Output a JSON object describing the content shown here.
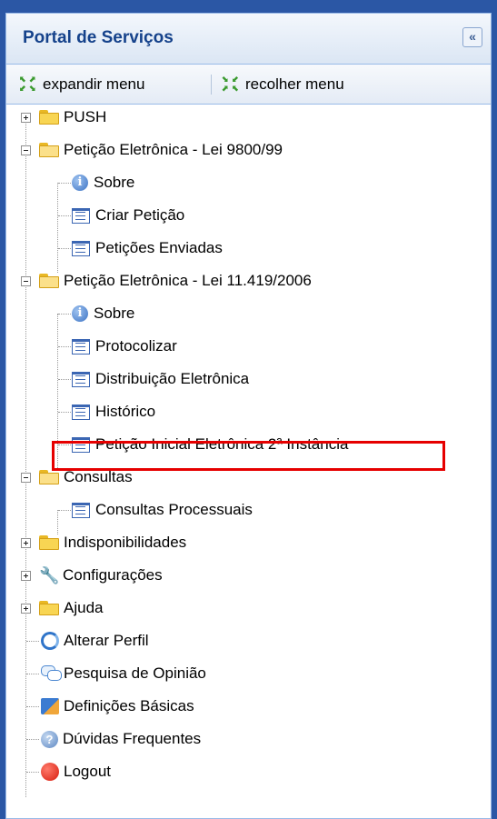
{
  "panel": {
    "title": "Portal de Serviços",
    "collapse_symbol": "«"
  },
  "toolbar": {
    "expand_label": "expandir menu",
    "collapse_label": "recolher menu"
  },
  "tree": {
    "push": "PUSH",
    "peticao_9800": "Petição Eletrônica - Lei 9800/99",
    "peticao_9800_children": [
      "Sobre",
      "Criar Petição",
      "Petições Enviadas"
    ],
    "peticao_11419": "Petição Eletrônica - Lei 11.419/2006",
    "peticao_11419_children": [
      "Sobre",
      "Protocolizar",
      "Distribuição Eletrônica",
      "Histórico",
      "Petição Inicial Eletrônica 2ª Instância"
    ],
    "consultas": "Consultas",
    "consultas_children": [
      "Consultas Processuais"
    ],
    "indisponibilidades": "Indisponibilidades",
    "configuracoes": "Configurações",
    "ajuda": "Ajuda",
    "alterar_perfil": "Alterar Perfil",
    "pesquisa_opiniao": "Pesquisa de Opinião",
    "definicoes_basicas": "Definições Básicas",
    "duvidas_frequentes": "Dúvidas Frequentes",
    "logout": "Logout"
  },
  "colors": {
    "frame": "#2b57a5",
    "title": "#15428b",
    "highlight": "#e60000"
  }
}
